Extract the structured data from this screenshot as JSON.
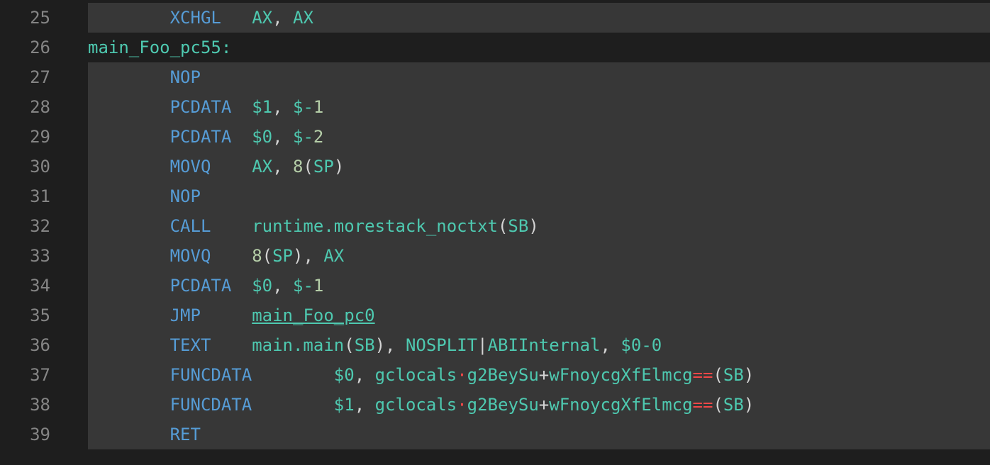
{
  "editor": {
    "line_numbers": [
      "25",
      "26",
      "27",
      "28",
      "29",
      "30",
      "31",
      "32",
      "33",
      "34",
      "35",
      "36",
      "37",
      "38",
      "39"
    ],
    "lines": [
      {
        "indent": "        ",
        "op": "XCHGL",
        "pad": "   ",
        "parts": [
          {
            "t": "AX",
            "c": "arg"
          },
          {
            "t": ", ",
            "c": "plain"
          },
          {
            "t": "AX",
            "c": "arg"
          }
        ]
      },
      {
        "label": "main_Foo_pc55:"
      },
      {
        "indent": "        ",
        "op": "NOP",
        "pad": "",
        "parts": []
      },
      {
        "indent": "        ",
        "op": "PCDATA",
        "pad": "  ",
        "parts": [
          {
            "t": "$1",
            "c": "arg"
          },
          {
            "t": ", ",
            "c": "plain"
          },
          {
            "t": "$-",
            "c": "arg"
          },
          {
            "t": "1",
            "c": "num"
          }
        ]
      },
      {
        "indent": "        ",
        "op": "PCDATA",
        "pad": "  ",
        "parts": [
          {
            "t": "$0",
            "c": "arg"
          },
          {
            "t": ", ",
            "c": "plain"
          },
          {
            "t": "$-",
            "c": "arg"
          },
          {
            "t": "2",
            "c": "num"
          }
        ]
      },
      {
        "indent": "        ",
        "op": "MOVQ",
        "pad": "    ",
        "parts": [
          {
            "t": "AX",
            "c": "arg"
          },
          {
            "t": ", ",
            "c": "plain"
          },
          {
            "t": "8",
            "c": "num"
          },
          {
            "t": "(",
            "c": "plain"
          },
          {
            "t": "SP",
            "c": "arg"
          },
          {
            "t": ")",
            "c": "plain"
          }
        ]
      },
      {
        "indent": "        ",
        "op": "NOP",
        "pad": "",
        "parts": []
      },
      {
        "indent": "        ",
        "op": "CALL",
        "pad": "    ",
        "parts": [
          {
            "t": "runtime.morestack_noctxt",
            "c": "arg"
          },
          {
            "t": "(",
            "c": "plain"
          },
          {
            "t": "SB",
            "c": "arg"
          },
          {
            "t": ")",
            "c": "plain"
          }
        ]
      },
      {
        "indent": "        ",
        "op": "MOVQ",
        "pad": "    ",
        "parts": [
          {
            "t": "8",
            "c": "num"
          },
          {
            "t": "(",
            "c": "plain"
          },
          {
            "t": "SP",
            "c": "arg"
          },
          {
            "t": "), ",
            "c": "plain"
          },
          {
            "t": "AX",
            "c": "arg"
          }
        ]
      },
      {
        "indent": "        ",
        "op": "PCDATA",
        "pad": "  ",
        "parts": [
          {
            "t": "$0",
            "c": "arg"
          },
          {
            "t": ", ",
            "c": "plain"
          },
          {
            "t": "$-",
            "c": "arg"
          },
          {
            "t": "1",
            "c": "num"
          }
        ]
      },
      {
        "indent": "        ",
        "op": "JMP",
        "pad": "     ",
        "parts": [
          {
            "t": "main_Foo_pc0",
            "c": "link"
          }
        ]
      },
      {
        "indent": "        ",
        "op": "TEXT",
        "pad": "    ",
        "parts": [
          {
            "t": "main.main",
            "c": "arg"
          },
          {
            "t": "(",
            "c": "plain"
          },
          {
            "t": "SB",
            "c": "arg"
          },
          {
            "t": "), ",
            "c": "plain"
          },
          {
            "t": "NOSPLIT",
            "c": "arg"
          },
          {
            "t": "|",
            "c": "plain"
          },
          {
            "t": "ABIInternal",
            "c": "arg"
          },
          {
            "t": ", ",
            "c": "plain"
          },
          {
            "t": "$0-0",
            "c": "arg"
          }
        ]
      },
      {
        "indent": "        ",
        "op": "FUNCDATA",
        "pad": "        ",
        "parts": [
          {
            "t": "$0",
            "c": "arg"
          },
          {
            "t": ", ",
            "c": "plain"
          },
          {
            "t": "gclocals",
            "c": "arg"
          },
          {
            "t": "·",
            "c": "dot"
          },
          {
            "t": "g2BeySu",
            "c": "arg"
          },
          {
            "t": "+",
            "c": "plain"
          },
          {
            "t": "wFnoycgXfElmcg",
            "c": "arg"
          },
          {
            "t": "==",
            "c": "eqeq"
          },
          {
            "t": "(",
            "c": "plain"
          },
          {
            "t": "SB",
            "c": "arg"
          },
          {
            "t": ")",
            "c": "plain"
          }
        ]
      },
      {
        "indent": "        ",
        "op": "FUNCDATA",
        "pad": "        ",
        "parts": [
          {
            "t": "$1",
            "c": "arg"
          },
          {
            "t": ", ",
            "c": "plain"
          },
          {
            "t": "gclocals",
            "c": "arg"
          },
          {
            "t": "·",
            "c": "dot"
          },
          {
            "t": "g2BeySu",
            "c": "arg"
          },
          {
            "t": "+",
            "c": "plain"
          },
          {
            "t": "wFnoycgXfElmcg",
            "c": "arg"
          },
          {
            "t": "==",
            "c": "eqeq"
          },
          {
            "t": "(",
            "c": "plain"
          },
          {
            "t": "SB",
            "c": "arg"
          },
          {
            "t": ")",
            "c": "plain"
          }
        ]
      },
      {
        "indent": "        ",
        "op": "RET",
        "pad": "",
        "parts": []
      }
    ],
    "colors": {
      "background": "#1e1e1e",
      "highlight": "#373737",
      "opcode": "#569cd6",
      "operand": "#4ec9b0",
      "number": "#b5cea8",
      "punctuation": "#d4d4d4",
      "error": "#f44747"
    }
  }
}
